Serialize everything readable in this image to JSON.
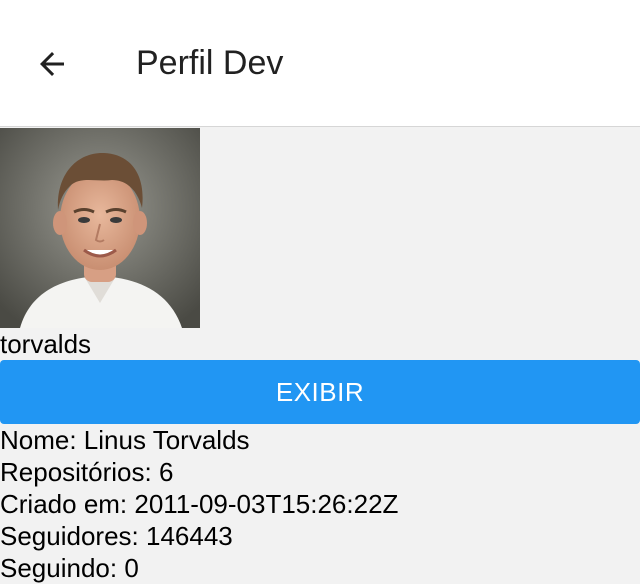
{
  "appbar": {
    "title": "Perfil Dev",
    "back_icon": "arrow-left-icon"
  },
  "profile": {
    "avatar_alt": "Foto de perfil",
    "username": "torvalds",
    "button_label": "EXIBIR",
    "button_color": "#2196f3",
    "details": [
      "Nome: Linus Torvalds",
      "Repositórios: 6",
      "Criado em: 2011-09-03T15:26:22Z",
      "Seguidores: 146443",
      "Seguindo: 0"
    ]
  }
}
